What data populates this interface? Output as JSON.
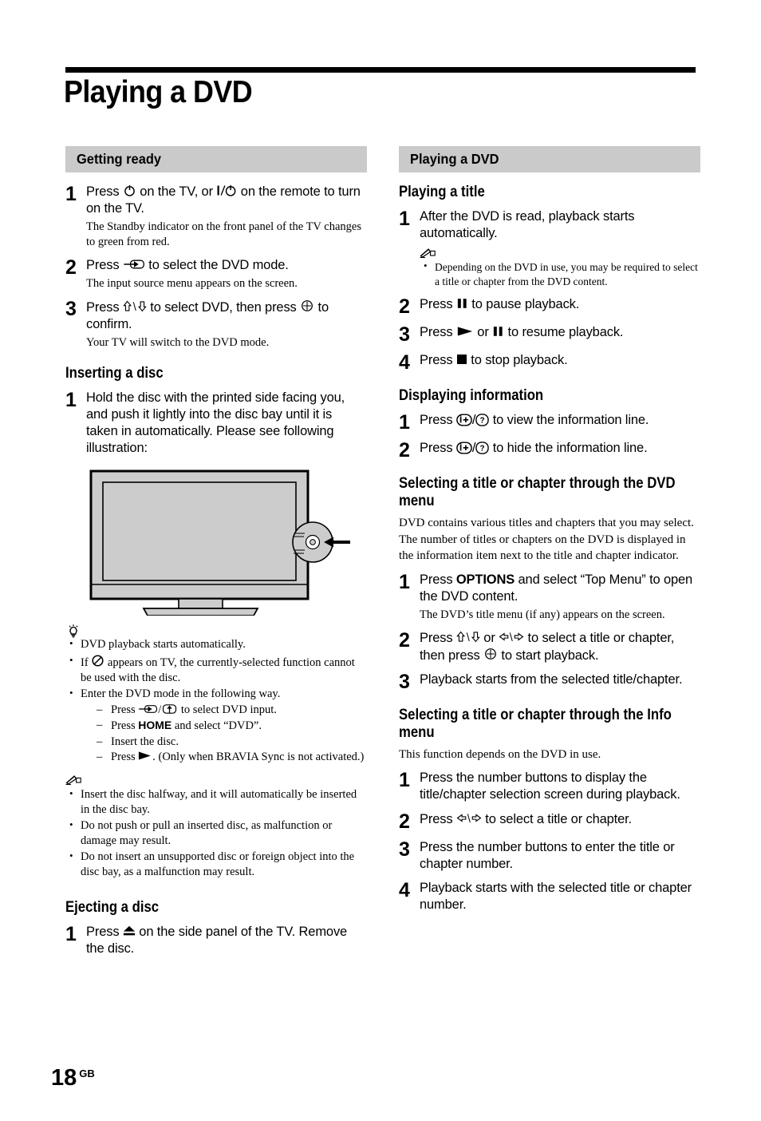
{
  "page": {
    "title": "Playing a DVD",
    "number": "18",
    "region_code": "GB"
  },
  "left_column": {
    "section_bar": "Getting ready",
    "steps": [
      {
        "num": "1",
        "text_a": "Press ",
        "icon_a": "power-icon",
        "text_b": " on the TV, or ",
        "icon_b": "standby-power-icon",
        "text_c": " on the remote to turn on the TV.",
        "sub": "The Standby indicator on the front panel of the TV changes to green from red."
      },
      {
        "num": "2",
        "text_a": "Press ",
        "icon_a": "input-select-icon",
        "text_b": " to select the DVD mode.",
        "sub": "The input source menu appears on the screen."
      },
      {
        "num": "3",
        "text_a": "Press ",
        "icon_a": "up-down-arrows-icon",
        "text_b": " to select DVD, then press ",
        "icon_b": "enter-confirm-icon",
        "text_c": " to confirm.",
        "sub": "Your TV will switch to the DVD mode."
      }
    ],
    "inserting": {
      "heading": "Inserting a disc",
      "step_num": "1",
      "step_text": "Hold the disc with the printed side facing you, and push it lightly into the disc bay until it is taken in automatically. Please see following illustration:"
    },
    "illustration": {
      "name": "tv-disc-insert-illustration",
      "alt": "Flat panel TV with disc being inserted into side disc bay"
    },
    "tips": {
      "icon": "tip-lightbulb-icon",
      "items": [
        {
          "text": "DVD playback starts automatically."
        },
        {
          "text_a": "If ",
          "icon": "prohibited-icon",
          "text_b": " appears on TV, the currently-selected function cannot be used with the disc."
        },
        {
          "text": "Enter the DVD mode in the following way.",
          "sub_items": [
            {
              "text_a": "Press ",
              "icon_a": "input-select-icon",
              "text_b": "/",
              "icon_b": "input-select-boxed-icon",
              "text_c": " to select DVD input."
            },
            {
              "text_a": "Press ",
              "bold": "HOME",
              "text_b": " and select “DVD”."
            },
            {
              "text_a": "Insert the disc."
            },
            {
              "text_a": "Press ",
              "icon_a": "play-icon",
              "text_b": ". (Only when BRAVIA Sync is not activated.)"
            }
          ]
        }
      ]
    },
    "notes": {
      "icon": "note-pencil-icon",
      "items": [
        "Insert the disc halfway, and it will automatically be inserted in the disc bay.",
        "Do not push or pull an inserted disc, as malfunction or damage may result.",
        "Do not insert an unsupported disc or foreign object into the disc bay, as a malfunction may result."
      ]
    },
    "ejecting": {
      "heading": "Ejecting a disc",
      "step_num": "1",
      "text_a": "Press ",
      "icon_a": "eject-icon",
      "text_b": " on the side panel of the TV. Remove the disc."
    }
  },
  "right_column": {
    "section_bar": "Playing a DVD",
    "playing_title": {
      "heading": "Playing a title",
      "step1": {
        "num": "1",
        "text": "After the DVD is read, playback starts automatically.",
        "note_icon": "note-pencil-icon",
        "note": "Depending on the DVD in use, you may be required to select a title or chapter from the DVD content."
      },
      "step2": {
        "num": "2",
        "text_a": "Press ",
        "icon_a": "pause-icon",
        "text_b": " to pause playback."
      },
      "step3": {
        "num": "3",
        "text_a": "Press ",
        "icon_a": "play-icon",
        "text_b": " or ",
        "icon_b": "pause-icon",
        "text_c": " to resume playback."
      },
      "step4": {
        "num": "4",
        "text_a": "Press ",
        "icon_a": "stop-icon",
        "text_b": " to stop playback."
      }
    },
    "displaying_information": {
      "heading": "Displaying information",
      "step1": {
        "num": "1",
        "text_a": "Press ",
        "icon_a": "info-plus-icon",
        "text_b": "/",
        "icon_b": "question-circle-icon",
        "text_c": " to view the information line."
      },
      "step2": {
        "num": "2",
        "text_a": "Press ",
        "icon_a": "info-plus-icon",
        "text_b": "/",
        "icon_b": "question-circle-icon",
        "text_c": " to hide the information line."
      }
    },
    "dvd_menu": {
      "heading": "Selecting a title or chapter through the DVD menu",
      "intro": "DVD contains various titles and chapters that you may select. The number of titles or chapters on the DVD is displayed in the information item next to the title and chapter indicator.",
      "step1": {
        "num": "1",
        "text_a": "Press ",
        "bold": "OPTIONS",
        "text_b": " and select “Top Menu” to open the DVD content.",
        "sub": "The DVD’s title menu (if any) appears on the screen."
      },
      "step2": {
        "num": "2",
        "text_a": "Press ",
        "icon_a": "up-down-arrows-icon",
        "text_b": " or ",
        "icon_b": "left-right-arrows-icon",
        "text_c": " to select a title or chapter, then press ",
        "icon_c": "enter-confirm-icon",
        "text_d": " to start playback."
      },
      "step3": {
        "num": "3",
        "text": "Playback starts from the selected title/chapter."
      }
    },
    "info_menu": {
      "heading": "Selecting a title or chapter through the Info menu",
      "intro": "This function depends on the DVD in use.",
      "step1": {
        "num": "1",
        "text": "Press the number buttons to display the title/chapter selection screen during playback."
      },
      "step2": {
        "num": "2",
        "text_a": "Press ",
        "icon_a": "left-right-arrows-icon",
        "text_b": " to select a title or chapter."
      },
      "step3": {
        "num": "3",
        "text": "Press the number buttons to enter the title or chapter number."
      },
      "step4": {
        "num": "4",
        "text": "Playback starts with the selected title or chapter number."
      }
    }
  },
  "colors": {
    "section_bar_bg": "#cacaca",
    "text": "#000000",
    "illustration_fill": "#cccccc",
    "page_bg": "#ffffff"
  }
}
